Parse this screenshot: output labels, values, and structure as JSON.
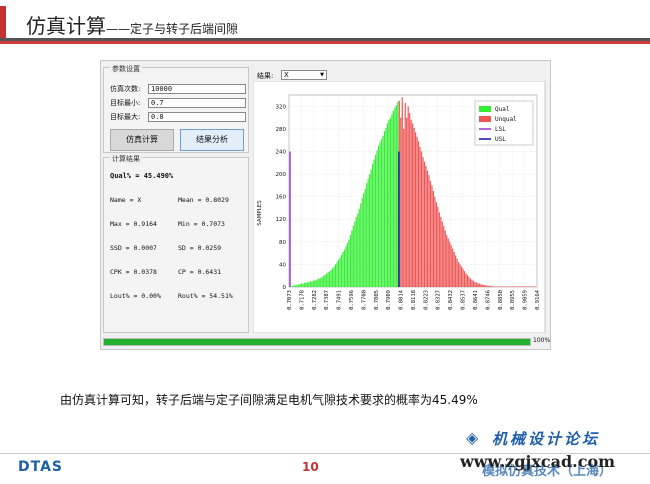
{
  "slide": {
    "title_main": "仿真计算",
    "title_sub": "——定子与转子后端间隙",
    "caption": "由仿真计算可知，转子后端与定子间隙满足电机气隙技术要求的概率为45.49%",
    "page_number": "10",
    "logo": "DTAS",
    "watermark_forum": "机械设计论坛",
    "watermark_url": "www.zgjxcad.com",
    "watermark_company": "模拟仿真技术（上海）"
  },
  "params": {
    "group_title": "参数设置",
    "fields": [
      {
        "label": "仿真次数:",
        "value": "10000"
      },
      {
        "label": "目标最小:",
        "value": "0.7"
      },
      {
        "label": "目标最大:",
        "value": "0.8"
      }
    ],
    "btn_calc": "仿真计算",
    "btn_analyze": "结果分析"
  },
  "results": {
    "group_title": "计算结果",
    "qual": "Qual% = 45.490%",
    "name_label": "Name = X",
    "mean": "Mean = 0.8029",
    "max": "Max = 0.9164",
    "min": "Min = 0.7073",
    "ssd": "SSD = 0.0007",
    "sd": "SD = 0.0259",
    "cpk": "CPK = 0.0378",
    "cp": "CP = 0.6431",
    "lout": "Lout% = 0.00%",
    "rout": "Rout% = 54.51%"
  },
  "selector": {
    "label": "结果:",
    "value": "X"
  },
  "progress": {
    "value": 100,
    "text": "100%"
  },
  "colors": {
    "qual": "#33ee33",
    "unqual": "#ee5555",
    "lsl": "#9933cc",
    "usl": "#1111aa",
    "progress": "#22b22e"
  },
  "chart_data": {
    "type": "bar",
    "ylabel": "SAMPLES",
    "ylim": [
      0,
      340
    ],
    "yticks": [
      0,
      40,
      80,
      120,
      160,
      200,
      240,
      280,
      320
    ],
    "xlim": [
      0.7073,
      0.9164
    ],
    "xticks": [
      "0.7073",
      "0.7178",
      "0.7282",
      "0.7387",
      "0.7491",
      "0.7596",
      "0.7700",
      "0.7805",
      "0.7909",
      "0.8014",
      "0.8118",
      "0.8223",
      "0.8327",
      "0.8432",
      "0.8537",
      "0.8641",
      "0.8746",
      "0.8850",
      "0.8955",
      "0.9059",
      "0.9164"
    ],
    "lsl": 0.7073,
    "usl": 0.8,
    "lsl_height": 240,
    "usl_height": 240,
    "legend": [
      "Qual",
      "Unqual",
      "LSL",
      "USL"
    ],
    "legend_position": "top-right",
    "bin_width": 0.00125,
    "bin_start": 0.7073,
    "bins": [
      2,
      1,
      2,
      3,
      3,
      4,
      4,
      5,
      6,
      6,
      7,
      8,
      8,
      9,
      10,
      10,
      11,
      12,
      12,
      14,
      15,
      16,
      18,
      20,
      22,
      24,
      26,
      28,
      30,
      33,
      36,
      40,
      44,
      48,
      52,
      57,
      62,
      66,
      72,
      78,
      84,
      92,
      100,
      108,
      116,
      124,
      130,
      138,
      148,
      158,
      166,
      174,
      184,
      192,
      200,
      208,
      218,
      226,
      234,
      242,
      250,
      256,
      262,
      268,
      276,
      282,
      290,
      296,
      300,
      306,
      312,
      318,
      322,
      328,
      330,
      300,
      336,
      280,
      326,
      300,
      320,
      308,
      296,
      290,
      282,
      274,
      266,
      258,
      248,
      240,
      230,
      222,
      214,
      206,
      198,
      188,
      180,
      170,
      160,
      150,
      142,
      132,
      124,
      116,
      108,
      100,
      92,
      86,
      80,
      74,
      68,
      62,
      56,
      50,
      44,
      40,
      36,
      32,
      28,
      24,
      21,
      18,
      15,
      13,
      11,
      9,
      8,
      7,
      6,
      5,
      4,
      4,
      3,
      3,
      2,
      2,
      2,
      1,
      1,
      1,
      1,
      1,
      1,
      1,
      1,
      1,
      1,
      1,
      1,
      1,
      1,
      1,
      1,
      1,
      1,
      1,
      1,
      1,
      1,
      1,
      1,
      1,
      1,
      1,
      1,
      1,
      1
    ]
  }
}
